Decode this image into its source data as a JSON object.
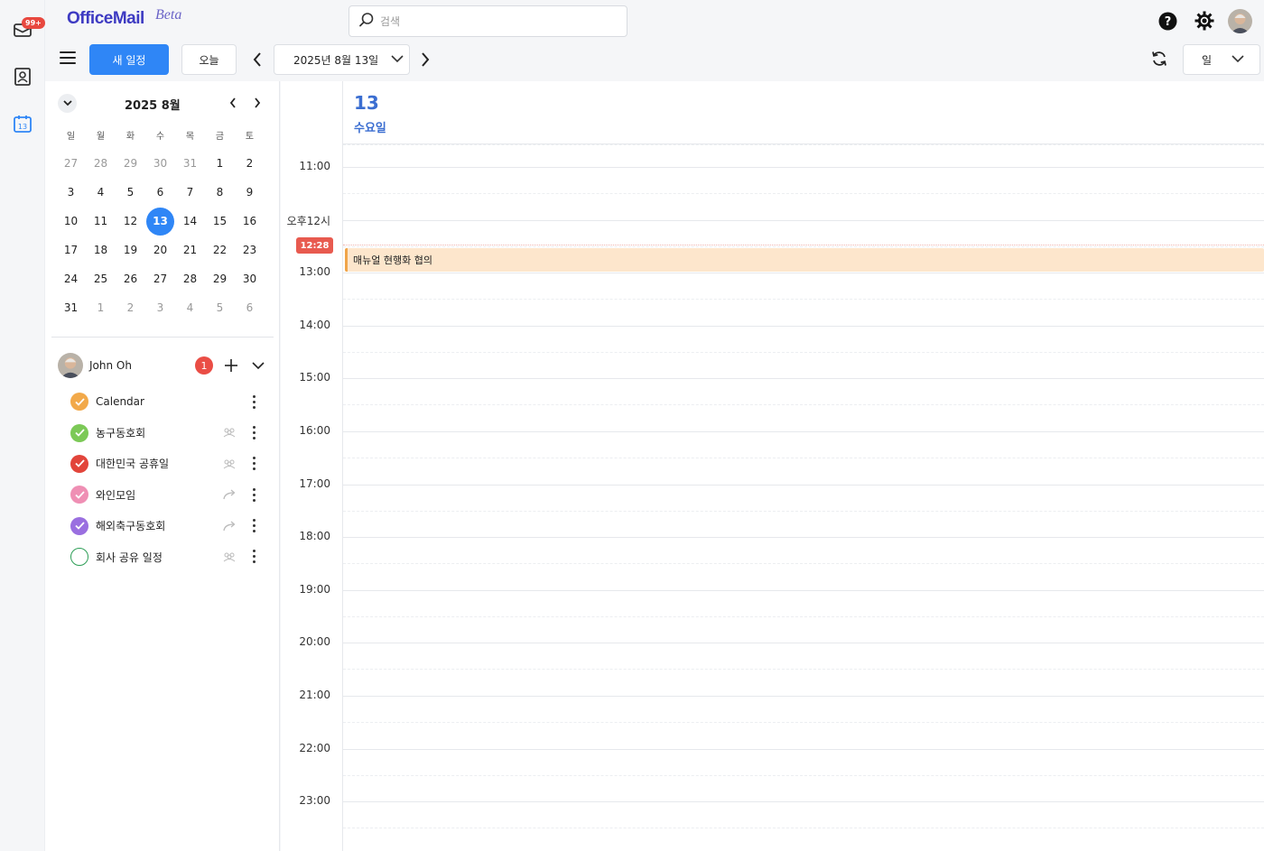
{
  "app": {
    "logo": "OfficeMail",
    "beta": "Beta"
  },
  "rail": {
    "mail_badge": "99+"
  },
  "search": {
    "placeholder": "검색"
  },
  "toolbar": {
    "new_event_label": "새 일정",
    "today_label": "오늘",
    "date_label": "2025년 8월 13일",
    "view_label": "일"
  },
  "mini_calendar": {
    "title": "2025 8월",
    "weekdays": [
      "일",
      "월",
      "화",
      "수",
      "목",
      "금",
      "토"
    ],
    "weeks": [
      [
        "27",
        "28",
        "29",
        "30",
        "31",
        "1",
        "2"
      ],
      [
        "3",
        "4",
        "5",
        "6",
        "7",
        "8",
        "9"
      ],
      [
        "10",
        "11",
        "12",
        "13",
        "14",
        "15",
        "16"
      ],
      [
        "17",
        "18",
        "19",
        "20",
        "21",
        "22",
        "23"
      ],
      [
        "24",
        "25",
        "26",
        "27",
        "28",
        "29",
        "30"
      ],
      [
        "31",
        "1",
        "2",
        "3",
        "4",
        "5",
        "6"
      ]
    ],
    "selected": "13"
  },
  "owner": {
    "name": "John Oh",
    "badge": "1"
  },
  "calendars": [
    {
      "label": "Calendar",
      "color": "#f2a94a",
      "checked": true,
      "icon": "none"
    },
    {
      "label": "농구동호회",
      "color": "#7cc957",
      "checked": true,
      "icon": "shared-people-icon"
    },
    {
      "label": "대한민국 공휴일",
      "color": "#e2453b",
      "checked": true,
      "icon": "shared-people-icon"
    },
    {
      "label": "와인모임",
      "color": "#ef8fb4",
      "checked": true,
      "icon": "share-arrow-icon"
    },
    {
      "label": "해외축구동호회",
      "color": "#9a6fe0",
      "checked": true,
      "icon": "share-arrow-icon"
    },
    {
      "label": "회사 공유 일정",
      "color": "#2e9e57",
      "checked": false,
      "icon": "shared-people-icon"
    }
  ],
  "day_view": {
    "day_number": "13",
    "day_name": "수요일",
    "hours": [
      "11:00",
      "오후12시",
      "13:00",
      "14:00",
      "15:00",
      "16:00",
      "17:00",
      "18:00",
      "19:00",
      "20:00",
      "21:00",
      "22:00",
      "23:00"
    ],
    "now_label": "12:28",
    "events": [
      {
        "title": "매뉴얼 현행화 협의",
        "color": "#f0a54a"
      }
    ]
  }
}
